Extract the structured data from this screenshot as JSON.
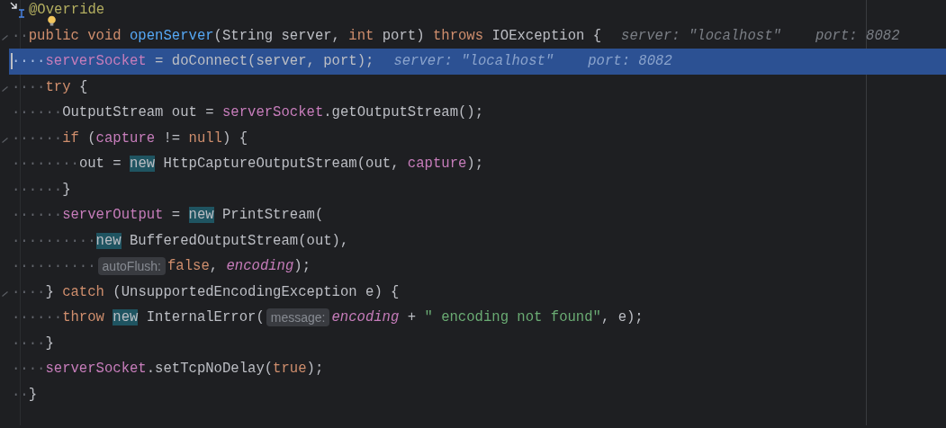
{
  "editor": {
    "lines": [
      {
        "implements_marker": true,
        "fold": false,
        "bulb": false,
        "selected": false,
        "tokens": [
          {
            "kind": "annotation",
            "text": "@Override"
          }
        ]
      },
      {
        "fold": true,
        "bulb": true,
        "selected": false,
        "tokens": [
          {
            "kind": "whitespace",
            "text": "··"
          },
          {
            "kind": "keyword",
            "text": "public void "
          },
          {
            "kind": "method",
            "text": "openServer"
          },
          {
            "kind": "plain",
            "text": "(String server, "
          },
          {
            "kind": "keyword",
            "text": "int "
          },
          {
            "kind": "plain",
            "text": "port) "
          },
          {
            "kind": "keyword",
            "text": "throws "
          },
          {
            "kind": "plain",
            "text": "IOException {"
          }
        ],
        "debug_values": [
          "server: \"localhost\"",
          "port: 8082"
        ]
      },
      {
        "fold": false,
        "bulb": false,
        "selected": true,
        "tokens": [
          {
            "kind": "whitespace",
            "text": "····"
          },
          {
            "kind": "field",
            "text": "serverSocket"
          },
          {
            "kind": "plain",
            "text": " = doConnect(server, port);"
          }
        ],
        "debug_values": [
          "server: \"localhost\"",
          "port: 8082"
        ]
      },
      {
        "fold": true,
        "bulb": false,
        "selected": false,
        "tokens": [
          {
            "kind": "whitespace",
            "text": "····"
          },
          {
            "kind": "keyword",
            "text": "try "
          },
          {
            "kind": "plain",
            "text": "{"
          }
        ]
      },
      {
        "fold": false,
        "bulb": false,
        "selected": false,
        "tokens": [
          {
            "kind": "whitespace",
            "text": "······"
          },
          {
            "kind": "plain",
            "text": "OutputStream out = "
          },
          {
            "kind": "field",
            "text": "serverSocket"
          },
          {
            "kind": "plain",
            "text": ".getOutputStream();"
          }
        ]
      },
      {
        "fold": true,
        "bulb": false,
        "selected": false,
        "tokens": [
          {
            "kind": "whitespace",
            "text": "······"
          },
          {
            "kind": "keyword",
            "text": "if "
          },
          {
            "kind": "plain",
            "text": "("
          },
          {
            "kind": "field",
            "text": "capture "
          },
          {
            "kind": "plain",
            "text": "!= "
          },
          {
            "kind": "keyword",
            "text": "null"
          },
          {
            "kind": "plain",
            "text": ") {"
          }
        ]
      },
      {
        "fold": false,
        "bulb": false,
        "selected": false,
        "tokens": [
          {
            "kind": "whitespace",
            "text": "········"
          },
          {
            "kind": "plain",
            "text": "out = "
          },
          {
            "kind": "usage",
            "text": "new"
          },
          {
            "kind": "plain",
            "text": " HttpCaptureOutputStream(out, "
          },
          {
            "kind": "field",
            "text": "capture"
          },
          {
            "kind": "plain",
            "text": ");"
          }
        ]
      },
      {
        "fold": false,
        "bulb": false,
        "selected": false,
        "tokens": [
          {
            "kind": "whitespace",
            "text": "······"
          },
          {
            "kind": "plain",
            "text": "}"
          }
        ]
      },
      {
        "fold": false,
        "bulb": false,
        "selected": false,
        "tokens": [
          {
            "kind": "whitespace",
            "text": "······"
          },
          {
            "kind": "field",
            "text": "serverOutput"
          },
          {
            "kind": "plain",
            "text": " = "
          },
          {
            "kind": "usage",
            "text": "new"
          },
          {
            "kind": "plain",
            "text": " PrintStream("
          }
        ]
      },
      {
        "fold": false,
        "bulb": false,
        "selected": false,
        "tokens": [
          {
            "kind": "whitespace",
            "text": "··········"
          },
          {
            "kind": "usage",
            "text": "new"
          },
          {
            "kind": "plain",
            "text": " BufferedOutputStream(out),"
          }
        ]
      },
      {
        "fold": false,
        "bulb": false,
        "selected": false,
        "tokens": [
          {
            "kind": "whitespace",
            "text": "··········"
          },
          {
            "kind": "hint",
            "text": "autoFlush:"
          },
          {
            "kind": "keyword",
            "text": "false"
          },
          {
            "kind": "plain",
            "text": ", "
          },
          {
            "kind": "static",
            "text": "encoding"
          },
          {
            "kind": "plain",
            "text": ");"
          }
        ]
      },
      {
        "fold": true,
        "bulb": false,
        "selected": false,
        "tokens": [
          {
            "kind": "whitespace",
            "text": "····"
          },
          {
            "kind": "plain",
            "text": "} "
          },
          {
            "kind": "keyword",
            "text": "catch "
          },
          {
            "kind": "plain",
            "text": "(UnsupportedEncodingException e) {"
          }
        ]
      },
      {
        "fold": false,
        "bulb": false,
        "selected": false,
        "tokens": [
          {
            "kind": "whitespace",
            "text": "······"
          },
          {
            "kind": "keyword",
            "text": "throw "
          },
          {
            "kind": "usage",
            "text": "new"
          },
          {
            "kind": "plain",
            "text": " InternalError("
          },
          {
            "kind": "hint",
            "text": "message:"
          },
          {
            "kind": "static",
            "text": "encoding"
          },
          {
            "kind": "plain",
            "text": " + "
          },
          {
            "kind": "string",
            "text": "\" encoding not found\""
          },
          {
            "kind": "plain",
            "text": ", e);"
          }
        ]
      },
      {
        "fold": false,
        "bulb": false,
        "selected": false,
        "tokens": [
          {
            "kind": "whitespace",
            "text": "····"
          },
          {
            "kind": "plain",
            "text": "}"
          }
        ]
      },
      {
        "fold": false,
        "bulb": false,
        "selected": false,
        "tokens": [
          {
            "kind": "whitespace",
            "text": "····"
          },
          {
            "kind": "field",
            "text": "serverSocket"
          },
          {
            "kind": "plain",
            "text": ".setTcpNoDelay("
          },
          {
            "kind": "keyword",
            "text": "true"
          },
          {
            "kind": "plain",
            "text": ");"
          }
        ]
      },
      {
        "fold": false,
        "bulb": false,
        "selected": false,
        "tokens": [
          {
            "kind": "whitespace",
            "text": "··"
          },
          {
            "kind": "plain",
            "text": "}"
          }
        ]
      }
    ]
  }
}
